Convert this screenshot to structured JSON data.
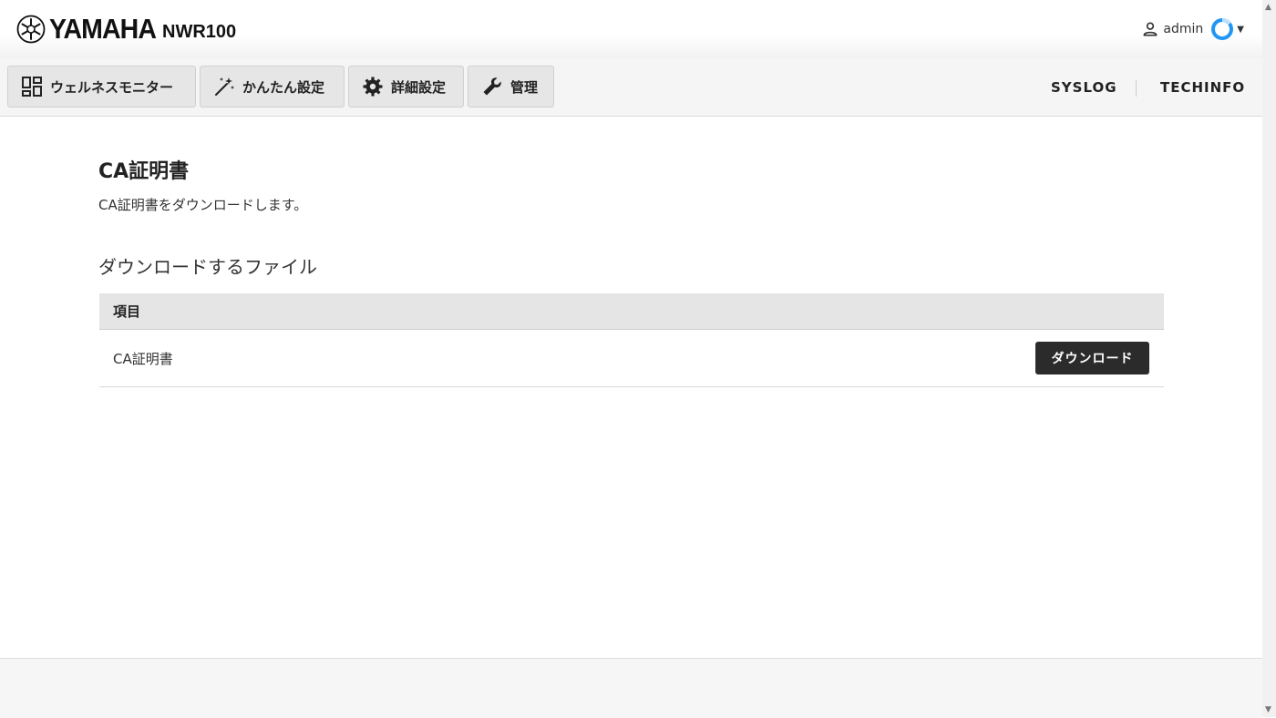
{
  "header": {
    "brand": "YAMAHA",
    "model": "NWR100",
    "user": {
      "name": "admin",
      "icon": "person-icon",
      "status_color": "#2196f3"
    }
  },
  "nav": {
    "buttons": [
      {
        "label": "ウェルネスモニター",
        "icon": "dashboard-icon"
      },
      {
        "label": "かんたん設定",
        "icon": "magic-wand-icon"
      },
      {
        "label": "詳細設定",
        "icon": "gear-icon"
      },
      {
        "label": "管理",
        "icon": "wrench-icon"
      }
    ],
    "links": [
      "SYSLOG",
      "TECHINFO"
    ]
  },
  "main": {
    "title": "CA証明書",
    "description": "CA証明書をダウンロードします。",
    "section_title": "ダウンロードするファイル",
    "table": {
      "header": "項目",
      "rows": [
        {
          "label": "CA証明書",
          "button": "ダウンロード"
        }
      ]
    }
  }
}
